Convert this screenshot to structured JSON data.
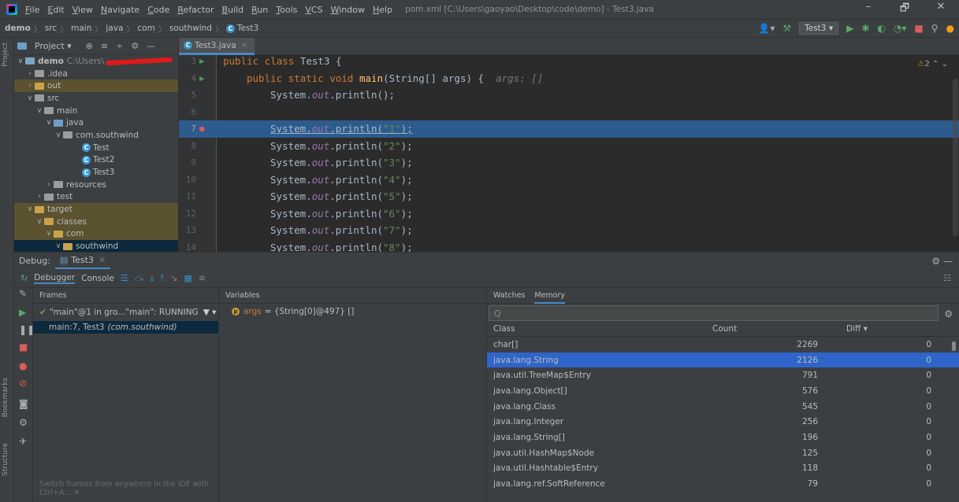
{
  "menubar": {
    "items": [
      "File",
      "Edit",
      "View",
      "Navigate",
      "Code",
      "Refactor",
      "Build",
      "Run",
      "Tools",
      "VCS",
      "Window",
      "Help"
    ],
    "window_title": "pom.xml [C:\\Users\\gaoyao\\Desktop\\code\\demo] - Test3.java",
    "controls": [
      "–",
      "🗗",
      "✕"
    ]
  },
  "navbar": {
    "crumbs": [
      "demo",
      "src",
      "main",
      "java",
      "com",
      "southwind",
      "Test3"
    ],
    "run_config": "Test3 ▾"
  },
  "left_stripe": {
    "project_label": "Project",
    "bookmarks_label": "Bookmarks",
    "structure_label": "Structure"
  },
  "project": {
    "title": "Project ▾",
    "tree": [
      {
        "arrow": "∨",
        "label": "demo",
        "path": "C:\\Users\\",
        "icon": "module",
        "indent": 0,
        "style": "",
        "bold": true,
        "redacted": true
      },
      {
        "arrow": "›",
        "label": ".idea",
        "icon": "folder",
        "indent": 1,
        "style": ""
      },
      {
        "arrow": "›",
        "label": "out",
        "icon": "folder-yellow",
        "indent": 1,
        "style": "hl-yellow"
      },
      {
        "arrow": "∨",
        "label": "src",
        "icon": "folder",
        "indent": 1,
        "style": ""
      },
      {
        "arrow": "∨",
        "label": "main",
        "icon": "folder",
        "indent": 2,
        "style": ""
      },
      {
        "arrow": "∨",
        "label": "java",
        "icon": "folder-blue",
        "indent": 3,
        "style": ""
      },
      {
        "arrow": "∨",
        "label": "com.southwind",
        "icon": "package",
        "indent": 4,
        "style": ""
      },
      {
        "arrow": "",
        "label": "Test",
        "icon": "class",
        "indent": 6,
        "style": ""
      },
      {
        "arrow": "",
        "label": "Test2",
        "icon": "class",
        "indent": 6,
        "style": ""
      },
      {
        "arrow": "",
        "label": "Test3",
        "icon": "class",
        "indent": 6,
        "style": ""
      },
      {
        "arrow": "›",
        "label": "resources",
        "icon": "folder",
        "indent": 3,
        "style": ""
      },
      {
        "arrow": "›",
        "label": "test",
        "icon": "folder",
        "indent": 2,
        "style": ""
      },
      {
        "arrow": "∨",
        "label": "target",
        "icon": "folder-yellow",
        "indent": 1,
        "style": "hl-yellow"
      },
      {
        "arrow": "∨",
        "label": "classes",
        "icon": "folder-yellow",
        "indent": 2,
        "style": "hl-yellow"
      },
      {
        "arrow": "∨",
        "label": "com",
        "icon": "folder-yellow",
        "indent": 3,
        "style": "hl-yellow"
      },
      {
        "arrow": "∨",
        "label": "southwind",
        "icon": "folder-yellow",
        "indent": 4,
        "style": "sel"
      }
    ]
  },
  "editor": {
    "tab_label": "Test3.java",
    "warning_count": "2",
    "lines": [
      {
        "num": "3",
        "mark": "run",
        "exec": false
      },
      {
        "num": "4",
        "mark": "run",
        "exec": false
      },
      {
        "num": "5",
        "mark": "",
        "exec": false
      },
      {
        "num": "6",
        "mark": "",
        "exec": false
      },
      {
        "num": "7",
        "mark": "bp",
        "exec": true
      },
      {
        "num": "8",
        "mark": "",
        "exec": false
      },
      {
        "num": "9",
        "mark": "",
        "exec": false
      },
      {
        "num": "10",
        "mark": "",
        "exec": false
      },
      {
        "num": "11",
        "mark": "",
        "exec": false
      },
      {
        "num": "12",
        "mark": "",
        "exec": false
      },
      {
        "num": "13",
        "mark": "",
        "exec": false
      },
      {
        "num": "14",
        "mark": "",
        "exec": false
      }
    ],
    "code": {
      "class_decl_kw": "public class ",
      "class_decl_rest": "Test3 {",
      "main_kw": "public static void ",
      "main_name": "main",
      "main_params": "(String[] args) {  ",
      "main_hint": "args: []",
      "println_prefix": "System.",
      "println_field": "out",
      "println_call": ".println(",
      "println_close": ");",
      "println_empty": "System.out.println();",
      "args": [
        "\"1\"",
        "\"2\"",
        "\"3\"",
        "\"4\"",
        "\"5\"",
        "\"6\"",
        "\"7\"",
        "\"8\""
      ]
    }
  },
  "debug": {
    "label": "Debug:",
    "tab_label": "Test3",
    "subtabs": [
      "Debugger",
      "Console"
    ],
    "frames_title": "Frames",
    "thread": "\"main\"@1 in gro...\"main\": RUNNING",
    "frame_main": "main:7, Test3",
    "frame_pkg": "(com.southwind)",
    "frames_hint": "Switch frames from anywhere in the IDE with Ctrl+A... ✕",
    "variables_title": "Variables",
    "var_name": "args",
    "var_value": "= {String[0]@497} []",
    "memory_tabs": [
      "Watches",
      "Memory"
    ],
    "memory_search_placeholder": "Q",
    "memory_headers": [
      "Class",
      "Count",
      "Diff ▾"
    ],
    "memory_rows": [
      {
        "cls": "char[]",
        "count": "2269",
        "diff": "0"
      },
      {
        "cls": "java.lang.String",
        "count": "2126",
        "diff": "0"
      },
      {
        "cls": "java.util.TreeMap$Entry",
        "count": "791",
        "diff": "0"
      },
      {
        "cls": "java.lang.Object[]",
        "count": "576",
        "diff": "0"
      },
      {
        "cls": "java.lang.Class",
        "count": "545",
        "diff": "0"
      },
      {
        "cls": "java.lang.Integer",
        "count": "256",
        "diff": "0"
      },
      {
        "cls": "java.lang.String[]",
        "count": "196",
        "diff": "0"
      },
      {
        "cls": "java.util.HashMap$Node",
        "count": "125",
        "diff": "0"
      },
      {
        "cls": "java.util.Hashtable$Entry",
        "count": "118",
        "diff": "0"
      },
      {
        "cls": "java.lang.ref.SoftReference",
        "count": "79",
        "diff": "0"
      }
    ],
    "selected_memory_row": 1
  }
}
